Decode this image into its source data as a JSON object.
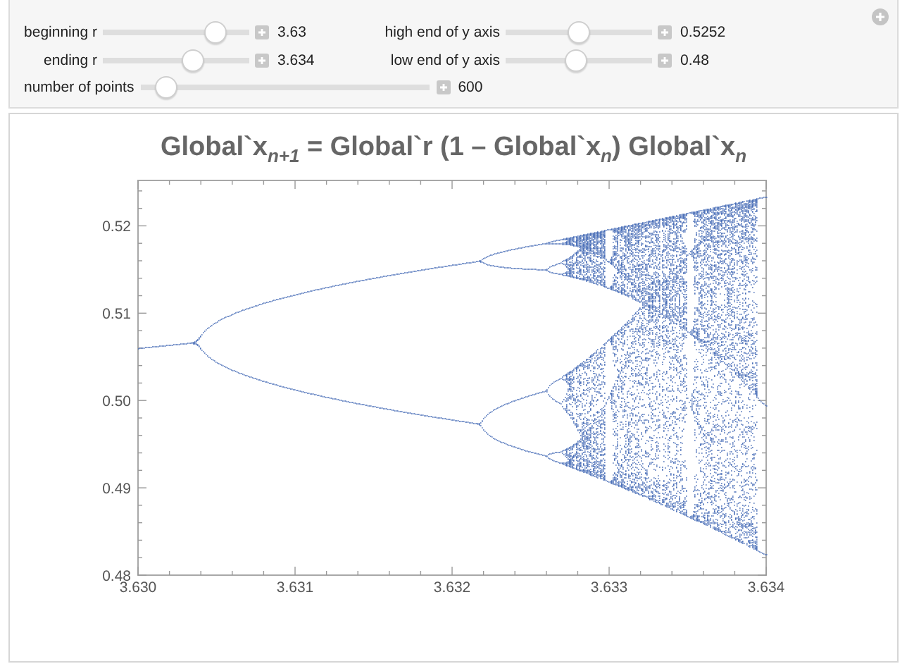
{
  "controls": [
    {
      "label": "beginning r",
      "level": 0.82,
      "value": "3.63"
    },
    {
      "label": "high end of y axis",
      "level": 0.5,
      "value": "0.5252"
    },
    {
      "label": "ending r",
      "level": 0.64,
      "value": "3.634"
    },
    {
      "label": "low end of y axis",
      "level": 0.48,
      "value": "0.48"
    }
  ],
  "points_control": {
    "label": "number of points",
    "level": 0.05,
    "value": "600"
  },
  "plot": {
    "title": "Global`x$_{n+1}$ = Global`r (1 – Global`x$_{n}$) Global`x$_{n}$",
    "y_axis_labels": [
      "0.52",
      "0.51",
      "0.50",
      "0.49",
      "0.48"
    ],
    "x_axis_labels": [
      "3.630",
      "3.631",
      "3.632",
      "3.633",
      "3.634"
    ]
  }
}
